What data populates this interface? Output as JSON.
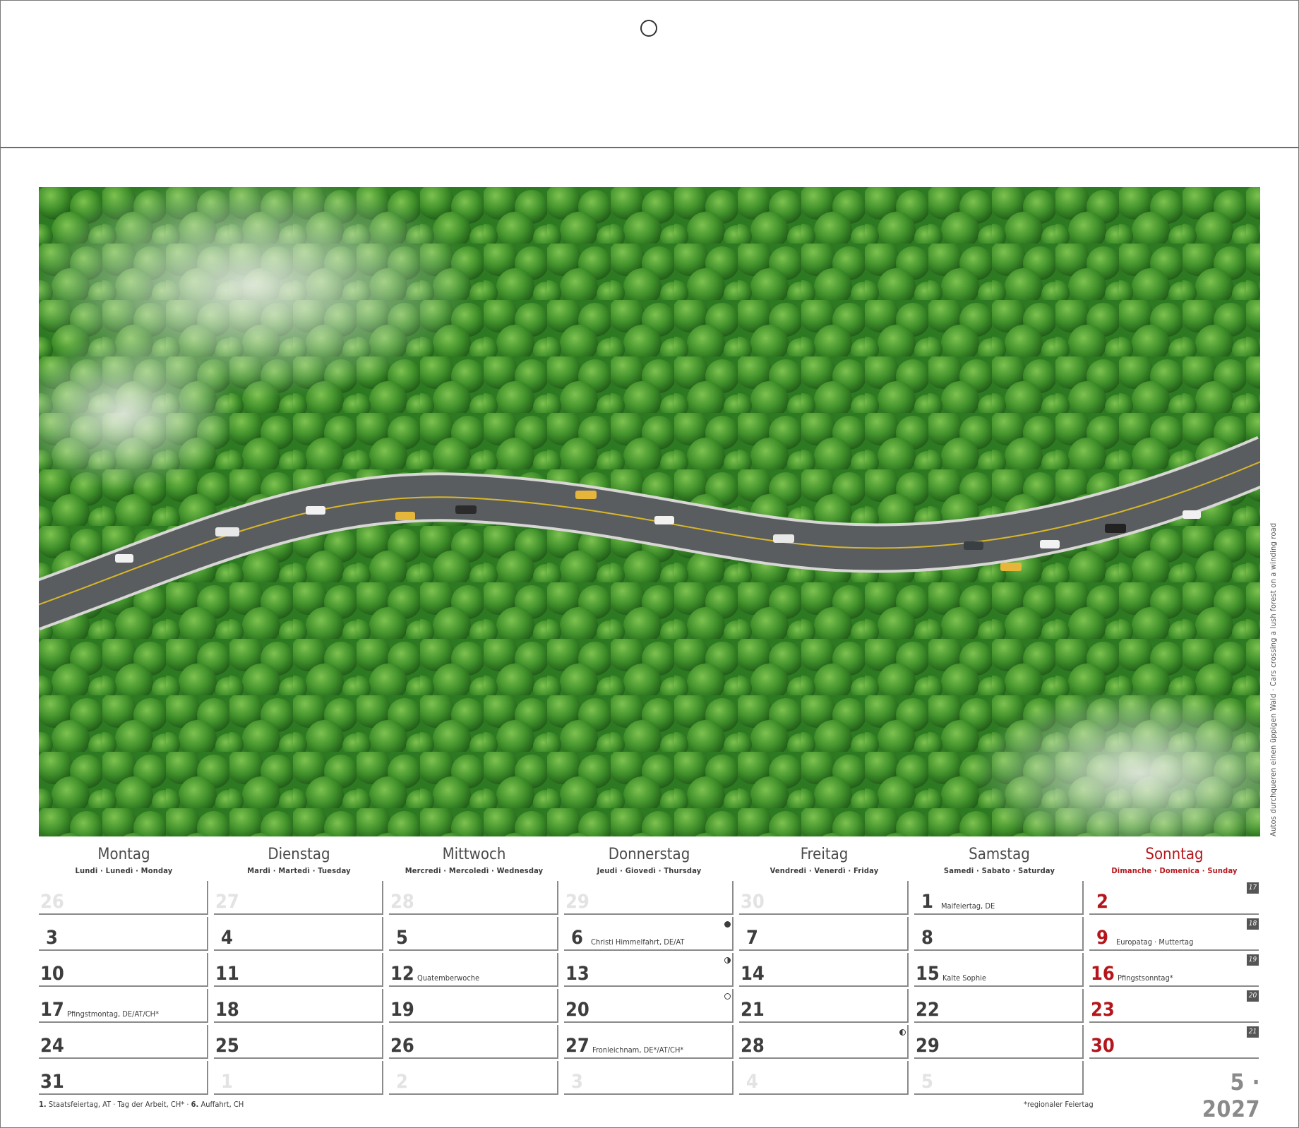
{
  "caption": "Autos durchqueren einen üppigen Wald · Cars crossing a lush forest on a winding road",
  "weekdays": [
    {
      "de": "Montag",
      "other": "Lundi · Lunedì · Monday"
    },
    {
      "de": "Dienstag",
      "other": "Mardi · Martedì · Tuesday"
    },
    {
      "de": "Mittwoch",
      "other": "Mercredi · Mercoledì · Wednesday"
    },
    {
      "de": "Donnerstag",
      "other": "Jeudi · Giovedì · Thursday"
    },
    {
      "de": "Freitag",
      "other": "Vendredi · Venerdì · Friday"
    },
    {
      "de": "Samstag",
      "other": "Samedi · Sabato · Saturday"
    },
    {
      "de": "Sonntag",
      "other": "Dimanche · Domenica · Sunday"
    }
  ],
  "weeks": [
    {
      "kw": "17",
      "days": [
        {
          "n": "26",
          "state": "faded"
        },
        {
          "n": "27",
          "state": "faded"
        },
        {
          "n": "28",
          "state": "faded"
        },
        {
          "n": "29",
          "state": "faded"
        },
        {
          "n": "30",
          "state": "faded"
        },
        {
          "n": "1",
          "note": "Maifeiertag, DE"
        },
        {
          "n": "2",
          "state": "sun"
        }
      ]
    },
    {
      "kw": "18",
      "days": [
        {
          "n": "3"
        },
        {
          "n": "4"
        },
        {
          "n": "5"
        },
        {
          "n": "6",
          "note": "Christi Himmelfahrt, DE/AT",
          "moon": "new"
        },
        {
          "n": "7"
        },
        {
          "n": "8"
        },
        {
          "n": "9",
          "state": "sun",
          "note": "Europatag · Muttertag"
        }
      ]
    },
    {
      "kw": "19",
      "days": [
        {
          "n": "10"
        },
        {
          "n": "11"
        },
        {
          "n": "12",
          "note": "Quatemberwoche"
        },
        {
          "n": "13",
          "moon": "firstq"
        },
        {
          "n": "14"
        },
        {
          "n": "15",
          "note": "Kalte Sophie"
        },
        {
          "n": "16",
          "state": "sun",
          "note": "Pfingstsonntag*"
        }
      ]
    },
    {
      "kw": "20",
      "days": [
        {
          "n": "17",
          "note": "Pfingstmontag, DE/AT/CH*"
        },
        {
          "n": "18"
        },
        {
          "n": "19"
        },
        {
          "n": "20",
          "moon": "full"
        },
        {
          "n": "21"
        },
        {
          "n": "22"
        },
        {
          "n": "23",
          "state": "sun"
        }
      ]
    },
    {
      "kw": "21",
      "days": [
        {
          "n": "24"
        },
        {
          "n": "25"
        },
        {
          "n": "26"
        },
        {
          "n": "27",
          "note": "Fronleichnam, DE*/AT/CH*"
        },
        {
          "n": "28",
          "moon": "lastq"
        },
        {
          "n": "29"
        },
        {
          "n": "30",
          "state": "sun"
        }
      ]
    },
    {
      "kw": "",
      "days": [
        {
          "n": "31"
        },
        {
          "n": "1",
          "state": "faded"
        },
        {
          "n": "2",
          "state": "faded"
        },
        {
          "n": "3",
          "state": "faded"
        },
        {
          "n": "4",
          "state": "faded"
        },
        {
          "n": "5",
          "state": "faded"
        }
      ]
    }
  ],
  "month_label": "5 · 2027",
  "footer": {
    "holidays_1_num": "1.",
    "holidays_1_text": "Staatsfeiertag, AT · Tag der Arbeit, CH*",
    "holidays_2_num": "6.",
    "holidays_2_text": "Auffahrt, CH",
    "regional_note": "*regionaler Feiertag"
  },
  "colors": {
    "sunday": "#b5161b",
    "text": "#3d3d3d",
    "faded": "#e3e3e3"
  }
}
